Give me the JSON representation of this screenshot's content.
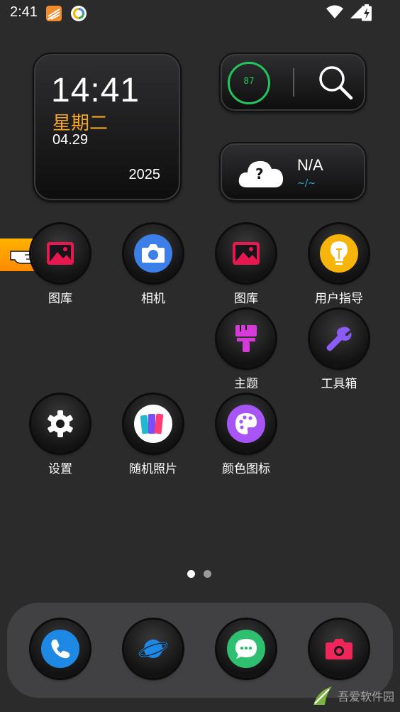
{
  "status_bar": {
    "time": "2:41"
  },
  "clock_widget": {
    "time": "14:41",
    "weekday": "星期二",
    "date": "04.29",
    "year": "2025"
  },
  "memory_widget": {
    "percent": "87"
  },
  "weather_widget": {
    "temperature": "N/A",
    "range": "~/~",
    "icon_text": "?"
  },
  "apps": [
    {
      "label": "图库"
    },
    {
      "label": "相机"
    },
    {
      "label": "图库"
    },
    {
      "label": "用户指导"
    },
    {
      "label": "主题"
    },
    {
      "label": "工具箱"
    },
    {
      "label": "设置"
    },
    {
      "label": "随机照片"
    },
    {
      "label": "颜色图标"
    }
  ],
  "watermark": {
    "text": "吾爱软件园"
  },
  "colors": {
    "accent_orange": "#f5a623",
    "ring_green": "#22c55e",
    "weather_cyan": "#2bb5d6"
  }
}
